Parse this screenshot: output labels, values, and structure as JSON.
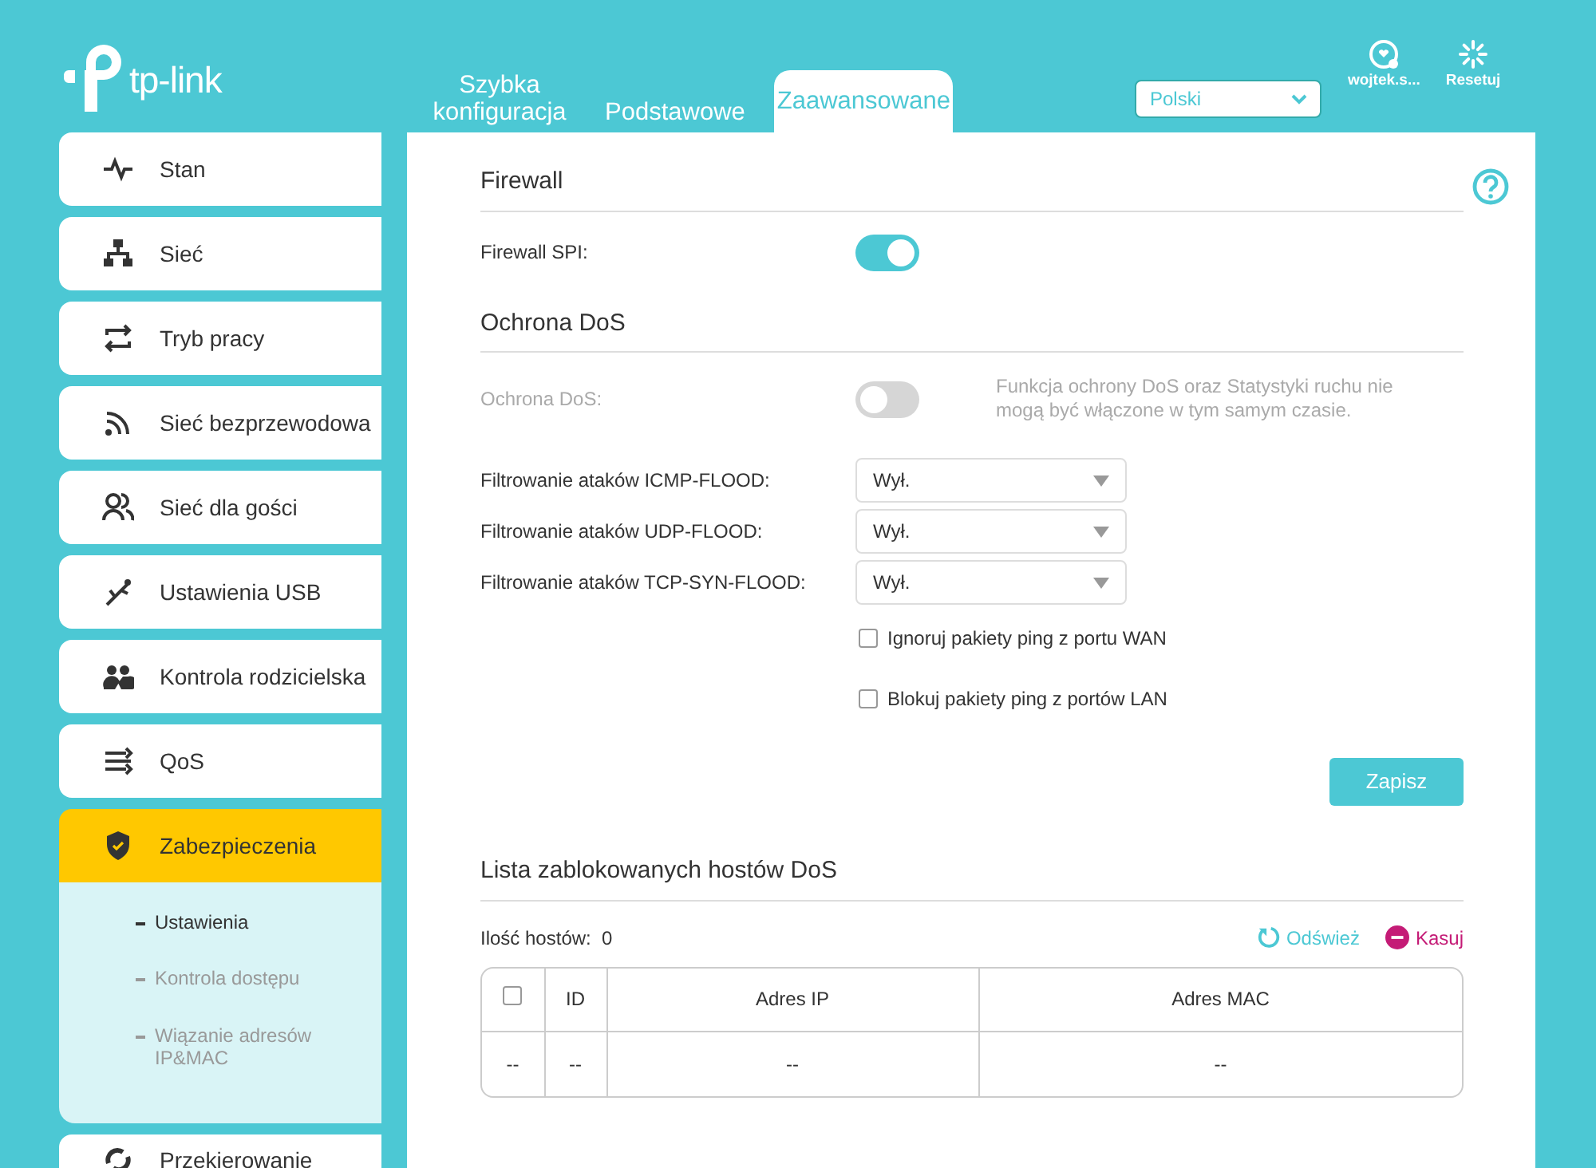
{
  "logo": {
    "text": "tp-link"
  },
  "tabs": [
    {
      "label": "Szybka konfiguracja",
      "selected": false
    },
    {
      "label": "Podstawowe",
      "selected": false
    },
    {
      "label": "Zaawansowane",
      "selected": true
    }
  ],
  "language": {
    "value": "Polski"
  },
  "header_actions": [
    {
      "label": "wojtek.s..."
    },
    {
      "label": "Resetuj"
    }
  ],
  "sidebar": {
    "items": [
      {
        "label": "Stan",
        "selected": false
      },
      {
        "label": "Sieć",
        "selected": false
      },
      {
        "label": "Tryb pracy",
        "selected": false
      },
      {
        "label": "Sieć bezprzewodowa",
        "selected": false
      },
      {
        "label": "Sieć dla gości",
        "selected": false
      },
      {
        "label": "Ustawienia USB",
        "selected": false
      },
      {
        "label": "Kontrola rodzicielska",
        "selected": false
      },
      {
        "label": "QoS",
        "selected": false
      },
      {
        "label": "Zabezpieczenia",
        "selected": true,
        "children": [
          {
            "label": "Ustawienia",
            "selected": true
          },
          {
            "label": "Kontrola dostępu",
            "selected": false
          },
          {
            "label": "Wiązanie adresów IP&MAC",
            "selected": false
          }
        ]
      },
      {
        "label": "Przekierowanie",
        "selected": false
      }
    ]
  },
  "firewall": {
    "title": "Firewall",
    "rows": [
      {
        "kind": "toggle",
        "label": "Firewall SPI:",
        "on": true,
        "disabled": false
      }
    ]
  },
  "dos": {
    "title": "Ochrona DoS",
    "rows": [
      {
        "kind": "toggle",
        "label": "Ochrona DoS:",
        "on": false,
        "disabled": true,
        "note": "Funkcja ochrony DoS oraz Statystyki ruchu nie mogą być włączone w tym samym czasie."
      },
      {
        "kind": "select",
        "label": "Filtrowanie ataków ICMP-FLOOD:",
        "value": "Wył."
      },
      {
        "kind": "select",
        "label": "Filtrowanie ataków UDP-FLOOD:",
        "value": "Wył."
      },
      {
        "kind": "select",
        "label": "Filtrowanie ataków TCP-SYN-FLOOD:",
        "value": "Wył."
      },
      {
        "kind": "checkbox",
        "label": "Ignoruj pakiety ping z portu WAN",
        "checked": false
      },
      {
        "kind": "checkbox",
        "label": "Blokuj pakiety ping z portów LAN",
        "checked": false
      }
    ],
    "save_button": "Zapisz"
  },
  "blocked_hosts": {
    "title": "Lista zablokowanych hostów DoS",
    "count_label": "Ilość hostów:",
    "count": "0",
    "actions": [
      {
        "kind": "refresh",
        "label": "Odśwież"
      },
      {
        "kind": "delete",
        "label": "Kasuj"
      }
    ],
    "table": {
      "columns": [
        {
          "kind": "checkbox",
          "checked": false
        },
        {
          "kind": "text",
          "label": "ID"
        },
        {
          "kind": "text",
          "label": "Adres IP"
        },
        {
          "kind": "text",
          "label": "Adres MAC"
        }
      ],
      "rows": [
        [
          "--",
          "--",
          "--",
          "--"
        ]
      ]
    }
  }
}
